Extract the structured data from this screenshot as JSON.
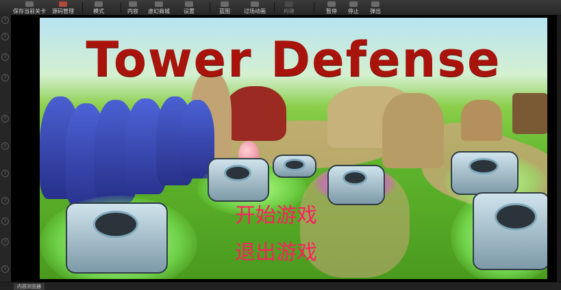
{
  "toolbar": {
    "buttons": [
      {
        "label": "保存当前关卡",
        "icon": "save-icon",
        "enabled": true
      },
      {
        "label": "源码管理",
        "icon": "source-control-icon",
        "enabled": true
      },
      {
        "label": "模式",
        "icon": "modes-icon",
        "enabled": true
      },
      {
        "label": "内容",
        "icon": "content-icon",
        "enabled": true
      },
      {
        "label": "虚幻商城",
        "icon": "marketplace-icon",
        "enabled": true
      },
      {
        "label": "设置",
        "icon": "settings-icon",
        "enabled": true
      },
      {
        "label": "蓝图",
        "icon": "blueprint-icon",
        "enabled": true
      },
      {
        "label": "过场动画",
        "icon": "cinematics-icon",
        "enabled": true
      },
      {
        "label": "构建",
        "icon": "build-icon",
        "enabled": false
      },
      {
        "label": "暂停",
        "icon": "pause-icon",
        "enabled": true
      },
      {
        "label": "停止",
        "icon": "stop-icon",
        "enabled": true
      },
      {
        "label": "弹出",
        "icon": "eject-icon",
        "enabled": true
      }
    ]
  },
  "game": {
    "title": "Tower Defense",
    "menu": {
      "start": "开始游戏",
      "quit": "退出游戏"
    },
    "colors": {
      "title": "#a8140c",
      "menu": "#ff1f5e"
    }
  },
  "statusbar": {
    "tab_label": "内容浏览器"
  }
}
